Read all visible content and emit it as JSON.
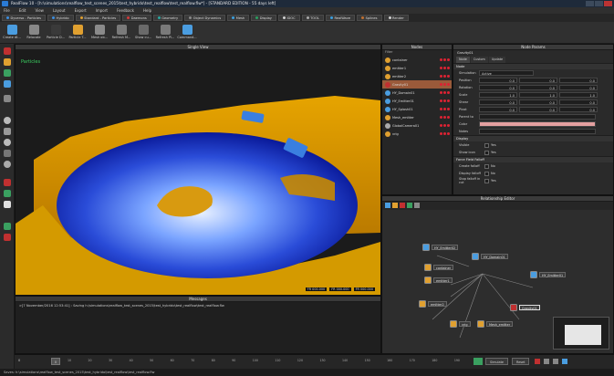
{
  "window": {
    "title": "RealFlow 10 - [h:\\simulations\\realflow_test_scenes_2015\\test_hybrido\\test_realflow\\test_realflow.flw*] - [STANDARD EDITION - 55 days left]"
  },
  "menu": [
    "File",
    "Edit",
    "View",
    "Layout",
    "Export",
    "Import",
    "Feedback",
    "Help"
  ],
  "tabs": [
    {
      "label": "Dyverso - Particles",
      "color": "#3c8ee0"
    },
    {
      "label": "Hybrido",
      "color": "#3c8ee0"
    },
    {
      "label": "Standard - Particles",
      "color": "#e0a030"
    },
    {
      "label": "Daemons",
      "color": "#d23a3a"
    },
    {
      "label": "Geometry",
      "color": "#2aa7a0"
    },
    {
      "label": "Object Dynamics",
      "color": "#888888"
    },
    {
      "label": "Mesh",
      "color": "#3aa0e0"
    },
    {
      "label": "Display",
      "color": "#2aa060"
    },
    {
      "label": "IDOC",
      "color": "#d0d0d0"
    },
    {
      "label": "TOOL",
      "color": "#aaaaaa"
    },
    {
      "label": "RealWave",
      "color": "#3aa0e0"
    },
    {
      "label": "Splines",
      "color": "#c07030"
    },
    {
      "label": "Render",
      "color": "#d0d0d0"
    }
  ],
  "toolbar": {
    "items": [
      {
        "label": "Create dt...",
        "color": "#4a9de0"
      },
      {
        "label": "Relocate",
        "color": "#888888"
      },
      {
        "label": "Particle D...",
        "color": "#3a3a3a"
      },
      {
        "label": "Particle T...",
        "color": "#e0a030"
      },
      {
        "label": "Mesh ob...",
        "color": "#8a8a8a"
      },
      {
        "label": "Refresh M...",
        "color": "#7a7a7a"
      },
      {
        "label": "Show cu...",
        "color": "#6a6a6a"
      },
      {
        "label": "Refresh Pl...",
        "color": "#7a7a7a"
      },
      {
        "label": "Command...",
        "color": "#4a9de0"
      }
    ]
  },
  "viewport": {
    "title": "Single View",
    "label": "Particles",
    "readout": [
      "FR 000.000",
      "FR 000.000",
      "FR 000.000"
    ]
  },
  "messages": {
    "title": "Messages",
    "line": ">[7 November/2016 12:53:41] : Saving h:\\simulations\\realflow_test_scenes_2015\\test_hybrido\\test_realflow\\test_realflow.flw"
  },
  "nodes": {
    "title": "Nodes",
    "filter": "Filter",
    "items": [
      {
        "label": "container",
        "color": "#e0a030",
        "selected": false
      },
      {
        "label": "emitter1",
        "color": "#e0a030",
        "selected": false
      },
      {
        "label": "emitter2",
        "color": "#e0a030",
        "selected": false
      },
      {
        "label": "Gravity01",
        "color": "#c03030",
        "selected": true
      },
      {
        "label": "HY_Domain01",
        "color": "#4a9de0",
        "selected": false
      },
      {
        "label": "HY_Emitter01",
        "color": "#4a9de0",
        "selected": false
      },
      {
        "label": "HY_Splash01",
        "color": "#4a9de0",
        "selected": false
      },
      {
        "label": "Mesh_emitter",
        "color": "#e0a030",
        "selected": false
      },
      {
        "label": "GlobalCamera01",
        "color": "#aaaaaa",
        "selected": false
      },
      {
        "label": "vrig",
        "color": "#e0a030",
        "selected": false
      }
    ]
  },
  "params": {
    "title": "Node Params",
    "node": "Gravity01",
    "tabs": [
      "Node",
      "Custom",
      "Update"
    ],
    "section_node": "Node",
    "rows": [
      {
        "label": "Simulation",
        "value": "Active",
        "v2": "",
        "v3": ""
      },
      {
        "label": "Position",
        "value": "0.0",
        "v2": "0.0",
        "v3": "0.0"
      },
      {
        "label": "Rotation",
        "value": "0.0",
        "v2": "0.0",
        "v3": "0.0"
      },
      {
        "label": "Scale",
        "value": "1.0",
        "v2": "1.0",
        "v3": "1.0"
      },
      {
        "label": "Shear",
        "value": "0.0",
        "v2": "0.0",
        "v3": "0.0"
      },
      {
        "label": "Pivot",
        "value": "0.0",
        "v2": "0.0",
        "v3": "0.0"
      },
      {
        "label": "Parent to",
        "value": "",
        "v2": "",
        "v3": ""
      },
      {
        "label": "Color",
        "value": "",
        "v2": "",
        "v3": ""
      },
      {
        "label": "Notes",
        "value": "",
        "v2": "",
        "v3": ""
      }
    ],
    "section_display": "Display",
    "display_rows": [
      {
        "label": "Visible",
        "value": "Yes"
      },
      {
        "label": "Show icon",
        "value": "Yes"
      }
    ],
    "section_force": "Force Field Falloff",
    "force_rows": [
      {
        "label": "Create falloff",
        "value": "No"
      },
      {
        "label": "Display falloff",
        "value": "No"
      },
      {
        "label": "Stop falloff in cut",
        "value": "Yes"
      }
    ]
  },
  "relations": {
    "title": "Relationship Editor",
    "graph_nodes": [
      {
        "label": "HY_Emitter02",
        "color": "#4a9de0"
      },
      {
        "label": "HY_Domain01",
        "color": "#4a9de0"
      },
      {
        "label": "container",
        "color": "#e0a030"
      },
      {
        "label": "emitter1",
        "color": "#e0a030"
      },
      {
        "label": "HY_Emitter01",
        "color": "#4a9de0"
      },
      {
        "label": "emitter2",
        "color": "#e0a030"
      },
      {
        "label": "Gravity01",
        "color": "#c03030"
      },
      {
        "label": "vrig",
        "color": "#e0a030"
      },
      {
        "label": "Mesh_emitter",
        "color": "#e0a030"
      }
    ]
  },
  "timeline": {
    "start": "0",
    "frame": "0",
    "ticks": [
      "10",
      "20",
      "30",
      "40",
      "50",
      "60",
      "70",
      "80",
      "90",
      "100",
      "110",
      "120",
      "130",
      "140",
      "150",
      "160",
      "170",
      "180",
      "190"
    ],
    "sim_mode": "Simulate",
    "reset": "Reset"
  },
  "status": {
    "text": "Saves: h:\\simulations\\realflow_test_scenes_2015\\test_hybrido\\test_realflow\\test_realflow.flw"
  }
}
